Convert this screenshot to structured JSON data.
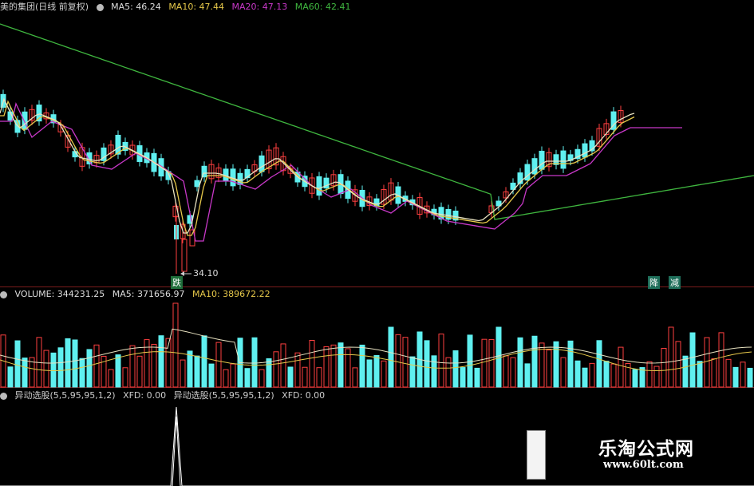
{
  "price_panel": {
    "title": "美的集团(日线 前复权)",
    "ma5": "MA5: 46.24",
    "ma10": "MA10: 47.44",
    "ma20": "MA20: 47.13",
    "ma60": "MA60: 42.41",
    "low_marker": "34.10",
    "signal_down": "跌",
    "signal_a": "降",
    "signal_b": "减",
    "colors": {
      "ma5": "#e8e2c0",
      "ma10": "#e6c84a",
      "ma20": "#c838c8",
      "ma60": "#3fb63f",
      "up": "#ff4040",
      "down": "#5ff0f0"
    }
  },
  "volume_panel": {
    "label": "VOLUME: 344231.25",
    "ma5": "MA5: 371656.97",
    "ma10": "MA10: 389672.22"
  },
  "indicator_panel": {
    "label1": "异动选股(5,5,95,95,1,2)",
    "xfd1": "XFD: 0.00",
    "label2": "异动选股(5,5,95,95,1,2)",
    "xfd2": "XFD: 0.00"
  },
  "watermark": {
    "title": "乐淘公式网",
    "url": "www.60lt.com"
  }
}
